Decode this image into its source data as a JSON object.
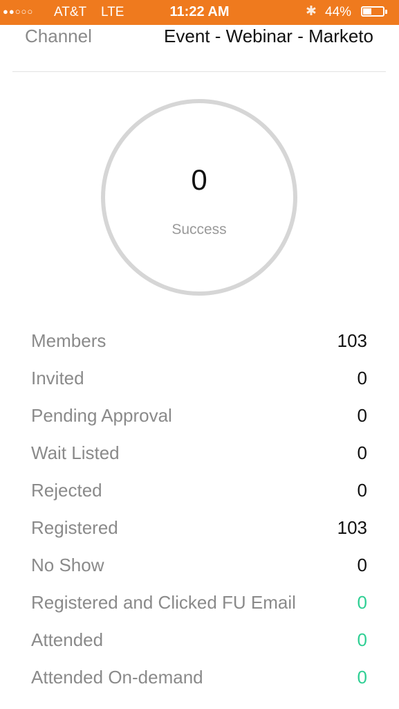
{
  "status_bar": {
    "signal": "●●○○○",
    "carrier": "AT&T",
    "network": "LTE",
    "time": "11:22 AM",
    "battery_percent": "44%",
    "battery_level": 0.44,
    "accent": "#ef7a1e"
  },
  "channel": {
    "label": "Channel",
    "value": "Event - Webinar - Marketo"
  },
  "success": {
    "value": "0",
    "label": "Success"
  },
  "stats": [
    {
      "label": "Members",
      "value": "103",
      "color": "#111111"
    },
    {
      "label": "Invited",
      "value": "0",
      "color": "#111111"
    },
    {
      "label": "Pending Approval",
      "value": "0",
      "color": "#111111"
    },
    {
      "label": "Wait Listed",
      "value": "0",
      "color": "#111111"
    },
    {
      "label": "Rejected",
      "value": "0",
      "color": "#111111"
    },
    {
      "label": "Registered",
      "value": "103",
      "color": "#111111"
    },
    {
      "label": "No Show",
      "value": "0",
      "color": "#111111"
    },
    {
      "label": "Registered and Clicked FU Email",
      "value": "0",
      "color": "#2fcf94"
    },
    {
      "label": "Attended",
      "value": "0",
      "color": "#2fcf94"
    },
    {
      "label": "Attended On-demand",
      "value": "0",
      "color": "#2fcf94"
    }
  ]
}
